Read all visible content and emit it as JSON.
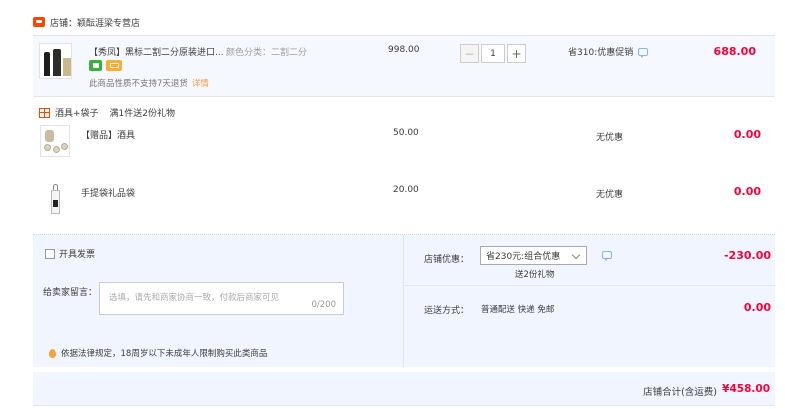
{
  "shop": {
    "label": "店铺：颖酝涯梁专营店"
  },
  "main_item": {
    "title": "【秀凤】黑标二割二分原装进口...",
    "sku": "颜色分类：二割二分",
    "return_note": "此商品性质不支持7天退货",
    "detail_link": "详情",
    "price": "998.00",
    "quantity": "1",
    "minus_label": "−",
    "plus_label": "+",
    "promo": "省310:优惠促销",
    "subtotal": "688.00"
  },
  "gift_section": {
    "title": "酒具+袋子",
    "rule": "满1件送2份礼物",
    "items": [
      {
        "title": "【赠品】酒具",
        "price": "50.00",
        "discount": "无优惠",
        "subtotal": "0.00"
      },
      {
        "title": "手提袋礼品袋",
        "price": "20.00",
        "discount": "无优惠",
        "subtotal": "0.00"
      }
    ]
  },
  "order": {
    "invoice_label": "开具发票",
    "memo_label": "给卖家留言：",
    "memo_placeholder": "选填，请先和商家协商一致，付款后商家可见",
    "memo_count": "0/200",
    "law_note": "依据法律规定，18周岁以下未成年人限制购买此类商品",
    "shop_promo_label": "店铺优惠：",
    "shop_promo_selected": "省230元:组合优惠",
    "gift_note": "送2份礼物",
    "shop_promo_amount": "-230.00",
    "shipping_label": "运送方式：",
    "shipping_value": "普通配送 快递 免邮",
    "shipping_amount": "0.00"
  },
  "total": {
    "label": "店铺合计(含运费)",
    "value": "¥458.00"
  },
  "colors": {
    "accent_red": "#ff0036",
    "row_bg": "#f5f8ff",
    "panel_bg": "#f0f5ff"
  },
  "icons": [
    "shop-badge-icon",
    "coupon-tag-icon",
    "card-tag-icon",
    "chat-icon",
    "gift-icon",
    "chevron-down-icon",
    "location-pin-icon"
  ]
}
